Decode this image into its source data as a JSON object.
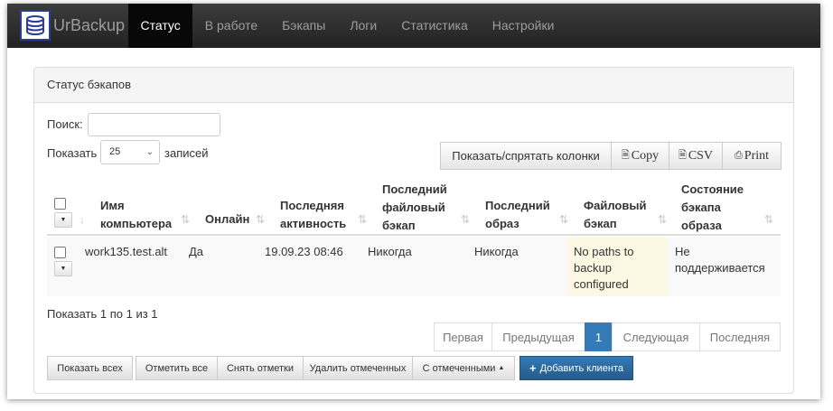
{
  "app": {
    "brand": "UrBackup"
  },
  "nav": [
    {
      "label": "Статус",
      "active": true
    },
    {
      "label": "В работе"
    },
    {
      "label": "Бэкапы"
    },
    {
      "label": "Логи"
    },
    {
      "label": "Статистика"
    },
    {
      "label": "Настройки"
    }
  ],
  "panel": {
    "title": "Статус бэкапов"
  },
  "search": {
    "label": "Поиск:",
    "value": ""
  },
  "length": {
    "prefix": "Показать",
    "value": "25",
    "suffix": "записей"
  },
  "table_buttons": {
    "colvis": "Показать/спрятать колонки",
    "copy": "Copy",
    "csv": "CSV",
    "print": "Print"
  },
  "columns": {
    "name": [
      "Имя",
      "компьютера"
    ],
    "online": [
      "Онлайн"
    ],
    "last_seen": [
      "Последняя",
      "активность"
    ],
    "last_file": [
      "Последний",
      "файловый",
      "бэкап"
    ],
    "last_image": [
      "Последний",
      "образ"
    ],
    "file_backup": [
      "Файловый",
      "бэкап"
    ],
    "image_status": [
      "Состояние",
      "бэкапа",
      "образа"
    ]
  },
  "rows": [
    {
      "name": "work135.test.alt",
      "online": "Да",
      "last_seen": "19.09.23 08:46",
      "last_file": "Никогда",
      "last_image": "Никогда",
      "file_backup": [
        "No paths to",
        "backup",
        "configured"
      ],
      "image_status": [
        "Не",
        "поддерживается"
      ]
    }
  ],
  "info": "Показать 1 по 1 из 1",
  "pagination": {
    "first": "Первая",
    "prev": "Предыдущая",
    "current": "1",
    "next": "Следующая",
    "last": "Последняя"
  },
  "actions": {
    "show_all": "Показать всех",
    "select_all": "Отметить все",
    "deselect": "Снять отметки",
    "delete_selected": "Удалить отмеченных",
    "with_selected": "С отмеченными",
    "add_client": "Добавить клиента"
  },
  "colors": {
    "navbar": "#222222",
    "primary": "#337ab7",
    "warning_cell": "#fcf8e3"
  }
}
